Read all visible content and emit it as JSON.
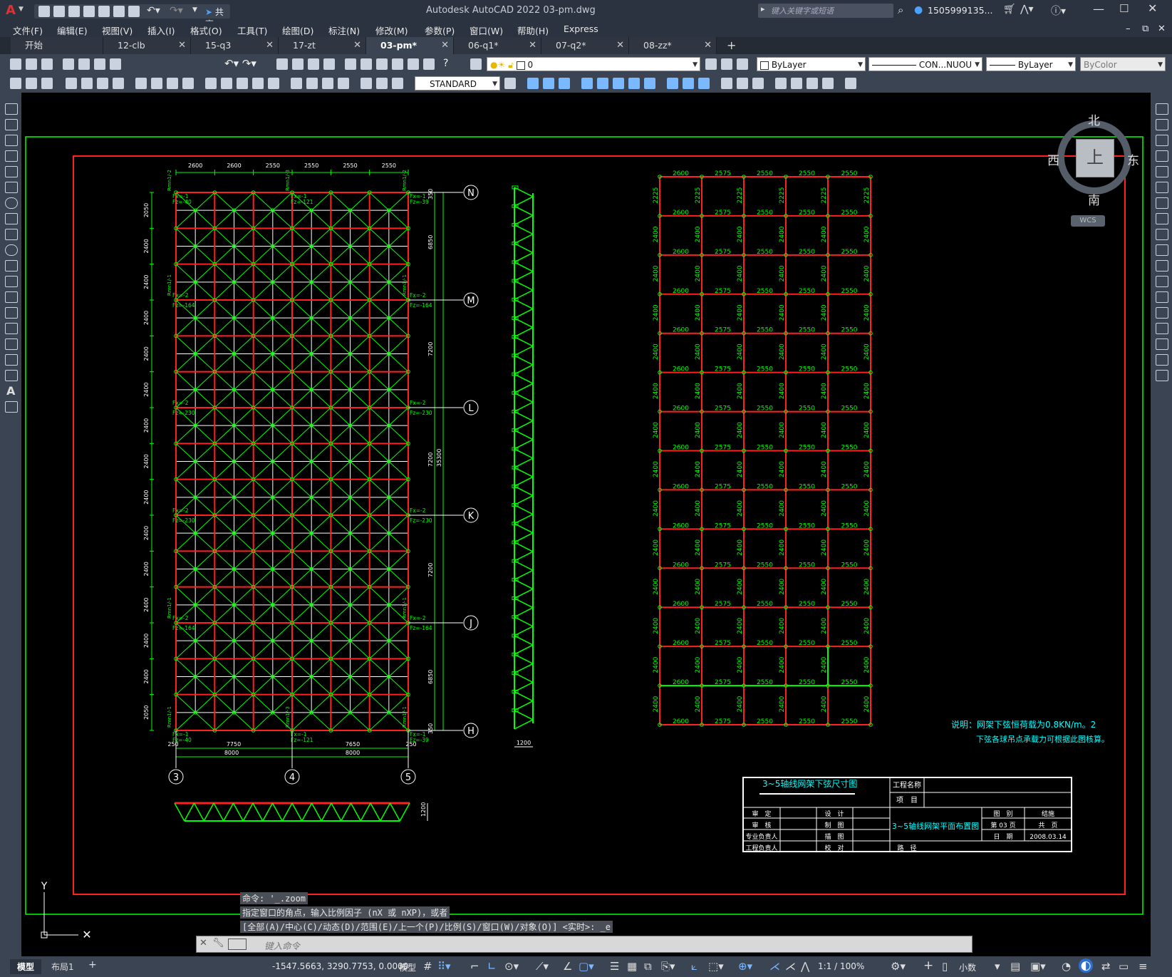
{
  "window": {
    "title": "Autodesk AutoCAD 2022    03-pm.dwg",
    "share_label": "共享",
    "search_placeholder": "键入关键字或短语",
    "user": "1505999135...",
    "app_letter": "A"
  },
  "menus": [
    "文件(F)",
    "编辑(E)",
    "视图(V)",
    "插入(I)",
    "格式(O)",
    "工具(T)",
    "绘图(D)",
    "标注(N)",
    "修改(M)",
    "参数(P)",
    "窗口(W)",
    "帮助(H)",
    "Express"
  ],
  "tabs": [
    {
      "label": "开始",
      "active": false,
      "closable": false
    },
    {
      "label": "12-clb",
      "active": false,
      "closable": true
    },
    {
      "label": "15-q3",
      "active": false,
      "closable": true
    },
    {
      "label": "17-zt",
      "active": false,
      "closable": true
    },
    {
      "label": "03-pm*",
      "active": true,
      "closable": true
    },
    {
      "label": "06-q1*",
      "active": false,
      "closable": true
    },
    {
      "label": "07-q2*",
      "active": false,
      "closable": true
    },
    {
      "label": "08-zz*",
      "active": false,
      "closable": true
    }
  ],
  "new_tab": "+",
  "properties": {
    "layer_value": "0",
    "color": "ByLayer",
    "linetype": "CON...NUOU",
    "lineweight": "ByLayer",
    "plotstyle": "ByColor",
    "text_style": "STANDARD"
  },
  "viewcube": {
    "north": "北",
    "south": "南",
    "east": "东",
    "west": "西",
    "face": "上",
    "wcs": "WCS"
  },
  "drawing": {
    "axes_vertical": [
      "3",
      "4",
      "5"
    ],
    "axes_horizontal": [
      "N",
      "M",
      "L",
      "K",
      "J",
      "H"
    ],
    "top_dims": [
      "2600",
      "2600",
      "2550",
      "2550",
      "2550",
      "2550"
    ],
    "bottom_dims": [
      "250",
      "7750",
      "7650",
      "250"
    ],
    "bottom_dims2": [
      "8000",
      "8000"
    ],
    "left_dims": [
      "2050",
      "2400",
      "2400",
      "2400",
      "2400",
      "2400",
      "2400",
      "2400",
      "2400",
      "2400",
      "2400",
      "2400",
      "2400",
      "2400",
      "2050"
    ],
    "right_dims": [
      "350",
      "6850",
      "7200",
      "7200",
      "35300",
      "7200",
      "6850",
      "350"
    ],
    "truss_dim": "1200",
    "loads": {
      "corner": [
        "Fx=-1",
        "Fz=-40",
        "Fz=-39",
        "Fz=-121"
      ],
      "side": [
        "Fx=-2",
        "Fz=-164",
        "Fz=-230"
      ],
      "support": [
        "Rmn1/-1",
        "Rmn1/-2",
        "Rmn1/-3"
      ]
    },
    "grid_right": {
      "col_widths": [
        "2600",
        "2575",
        "2550",
        "2550",
        "2550"
      ],
      "row_heights": [
        "2225",
        "2400",
        "2400",
        "2400",
        "2400",
        "2400",
        "2400",
        "2400",
        "2400",
        "2400",
        "2400",
        "2400",
        "2400",
        "2400",
        "2225"
      ]
    },
    "right_title": "3~5轴线网架下弦尺寸图",
    "note_line1": "说明：网架下弦恒荷载为0.8KN/m。2",
    "note_line2": "下弦各球吊点承载力可根据此图核算。",
    "titleblock": {
      "project_name_label": "工程名称",
      "project_label": "项　目",
      "drawing_name": "3~5轴线网架平面布置图",
      "cells": [
        "审　定",
        "设　计",
        "审　核",
        "制　图",
        "专业负责人",
        "描　图",
        "工程负责人",
        "校　对",
        "路　径"
      ],
      "right_cells": [
        "图　别",
        "结施",
        "第 03 页",
        "共　页",
        "日　期",
        "2008.03.14"
      ]
    }
  },
  "command": {
    "history": [
      "命令: '_.zoom",
      "指定窗口的角点，输入比例因子 (nX 或 nXP)，或者",
      "[全部(A)/中心(C)/动态(D)/范围(E)/上一个(P)/比例(S)/窗口(W)/对象(O)] <实时>: _e"
    ],
    "placeholder": "键入命令"
  },
  "status": {
    "layout_tabs": [
      "模型",
      "布局1"
    ],
    "coords": "-1547.5663, 3290.7753, 0.0000",
    "space": "模型",
    "scale": "1:1 / 100%",
    "units": "小数"
  },
  "colors": {
    "red": "#ff2020",
    "green": "#00ff00",
    "white": "#ffffff",
    "cyan": "#00ffff",
    "panel": "#3b4453"
  }
}
